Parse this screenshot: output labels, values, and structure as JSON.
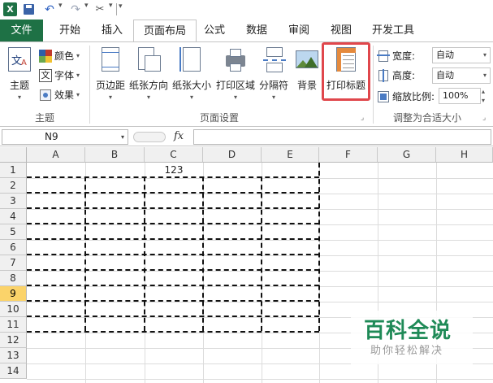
{
  "qat": {
    "app_icon": "excel-icon",
    "items": [
      "save-icon",
      "undo-icon",
      "redo-icon",
      "customize-icon"
    ]
  },
  "tabs": [
    {
      "label": "文件"
    },
    {
      "label": "开始"
    },
    {
      "label": "插入"
    },
    {
      "label": "页面布局"
    },
    {
      "label": "公式"
    },
    {
      "label": "数据"
    },
    {
      "label": "审阅"
    },
    {
      "label": "视图"
    },
    {
      "label": "开发工具"
    }
  ],
  "active_tab": "页面布局",
  "ribbon": {
    "theme_group": {
      "label": "主题",
      "themes_button": "主题",
      "colors": "颜色",
      "fonts": "字体",
      "effects": "效果"
    },
    "page_setup_group": {
      "label": "页面设置",
      "margins": "页边距",
      "orientation": "纸张方向",
      "size": "纸张大小",
      "print_area": "打印区域",
      "breaks": "分隔符",
      "background": "背景",
      "print_titles": "打印标题"
    },
    "scale_group": {
      "label": "调整为合适大小",
      "width_label": "宽度:",
      "width_value": "自动",
      "height_label": "高度:",
      "height_value": "自动",
      "scale_label": "缩放比例:",
      "scale_value": "100%"
    }
  },
  "formula_bar": {
    "name_box": "N9",
    "fx": "fx",
    "formula": ""
  },
  "sheet": {
    "columns": [
      "A",
      "B",
      "C",
      "D",
      "E",
      "F",
      "G",
      "H"
    ],
    "rows": [
      "1",
      "2",
      "3",
      "4",
      "5",
      "6",
      "7",
      "8",
      "9",
      "10",
      "11",
      "12",
      "13",
      "14"
    ],
    "selected_row": "9",
    "cells": {
      "C1": "123"
    }
  },
  "watermark": {
    "title": "百科全说",
    "subtitle": "助你轻松解决"
  },
  "colors": {
    "excel_green": "#1e7145",
    "highlight_red": "#e0474c",
    "watermark_green": "#1f8a57"
  }
}
